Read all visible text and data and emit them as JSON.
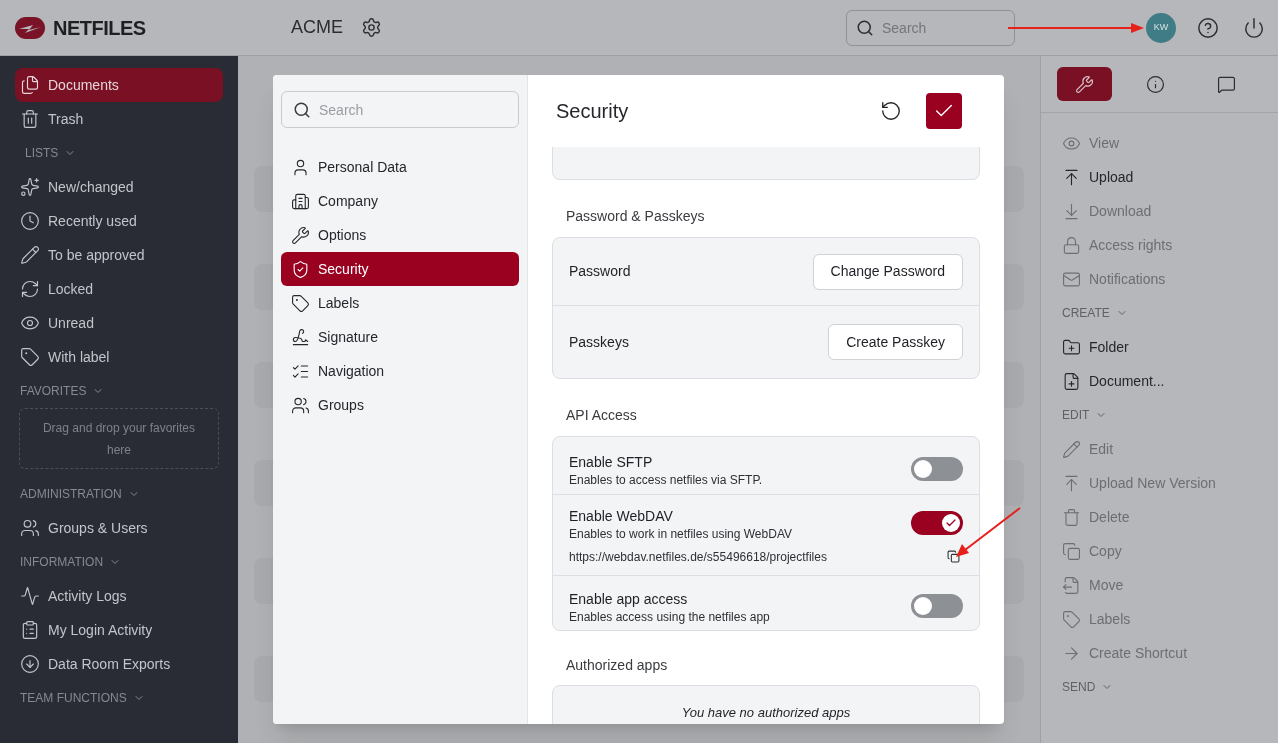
{
  "topbar": {
    "logo": "NETFILES",
    "workspace": "ACME",
    "search": {
      "placeholder": "Search"
    },
    "avatar": "KW"
  },
  "sidebar": {
    "main": [
      {
        "label": "Documents",
        "selected": true
      },
      {
        "label": "Trash",
        "selected": false
      }
    ],
    "sections": [
      {
        "title": "LISTS",
        "items": [
          {
            "label": "New/changed"
          },
          {
            "label": "Recently used"
          },
          {
            "label": "To be approved"
          },
          {
            "label": "Locked"
          },
          {
            "label": "Unread"
          },
          {
            "label": "With label"
          }
        ]
      },
      {
        "title": "FAVORITES",
        "dropzone": "Drag and drop your favorites here"
      },
      {
        "title": "ADMINISTRATION",
        "items": [
          {
            "label": "Groups & Users"
          }
        ]
      },
      {
        "title": "INFORMATION",
        "items": [
          {
            "label": "Activity Logs"
          },
          {
            "label": "My Login Activity"
          },
          {
            "label": "Data Room Exports"
          }
        ]
      },
      {
        "title": "TEAM FUNCTIONS"
      }
    ]
  },
  "right_panel": {
    "tabs": [
      {
        "selected": true
      },
      {
        "selected": false
      },
      {
        "selected": false
      }
    ],
    "groups": [
      {
        "items": [
          {
            "label": "View",
            "disabled": true
          },
          {
            "label": "Upload",
            "disabled": false
          },
          {
            "label": "Download",
            "disabled": true
          },
          {
            "label": "Access rights",
            "disabled": true
          },
          {
            "label": "Notifications",
            "disabled": true
          }
        ]
      },
      {
        "title": "CREATE",
        "items": [
          {
            "label": "Folder",
            "disabled": false
          },
          {
            "label": "Document...",
            "disabled": false
          }
        ]
      },
      {
        "title": "EDIT",
        "items": [
          {
            "label": "Edit",
            "disabled": true
          },
          {
            "label": "Upload New Version",
            "disabled": true
          },
          {
            "label": "Delete",
            "disabled": true
          },
          {
            "label": "Copy",
            "disabled": true
          },
          {
            "label": "Move",
            "disabled": true
          },
          {
            "label": "Labels",
            "disabled": true
          },
          {
            "label": "Create Shortcut",
            "disabled": true
          }
        ]
      },
      {
        "title": "SEND"
      }
    ]
  },
  "dialog": {
    "search": {
      "placeholder": "Search"
    },
    "nav": [
      {
        "label": "Personal Data",
        "selected": false
      },
      {
        "label": "Company",
        "selected": false
      },
      {
        "label": "Options",
        "selected": false
      },
      {
        "label": "Security",
        "selected": true
      },
      {
        "label": "Labels",
        "selected": false
      },
      {
        "label": "Signature",
        "selected": false
      },
      {
        "label": "Navigation",
        "selected": false
      },
      {
        "label": "Groups",
        "selected": false
      }
    ],
    "title": "Security",
    "password_section": {
      "title": "Password & Passkeys",
      "rows": [
        {
          "label": "Password",
          "button": "Change Password"
        },
        {
          "label": "Passkeys",
          "button": "Create Passkey"
        }
      ]
    },
    "api_section": {
      "title": "API Access",
      "rows": [
        {
          "label": "Enable SFTP",
          "description": "Enables to access netfiles via SFTP.",
          "on": false
        },
        {
          "label": "Enable WebDAV",
          "description": "Enables to work in netfiles using WebDAV",
          "on": true,
          "url": "https://webdav.netfiles.de/s55496618/projectfiles"
        },
        {
          "label": "Enable app access",
          "description": "Enables access using the netfiles app",
          "on": false
        }
      ]
    },
    "apps_section": {
      "title": "Authorized apps",
      "empty": "You have no authorized apps"
    }
  }
}
